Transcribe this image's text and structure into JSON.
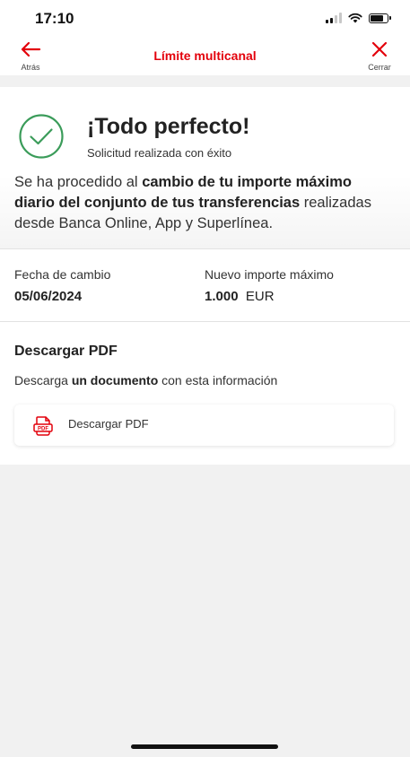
{
  "status_bar": {
    "time": "17:10"
  },
  "nav": {
    "title": "Límite multicanal",
    "back_label": "Atrás",
    "close_label": "Cerrar"
  },
  "success": {
    "title": "¡Todo perfecto!",
    "subtitle": "Solicitud realizada con éxito",
    "description_prefix": "Se ha procedido al ",
    "description_bold": "cambio de tu importe máximo diario del conjunto de tus transferencias",
    "description_suffix": " realizadas desde Banca Online, App y Superlínea."
  },
  "details": {
    "date_label": "Fecha de cambio",
    "date_value": "05/06/2024",
    "amount_label": "Nuevo importe máximo",
    "amount_value": "1.000",
    "amount_currency": "EUR"
  },
  "pdf": {
    "heading": "Descargar PDF",
    "desc_prefix": "Descarga ",
    "desc_bold": "un documento",
    "desc_suffix": " con esta información",
    "button_label": "Descargar PDF",
    "icon_text": "PDF"
  },
  "colors": {
    "brand_red": "#e3000b",
    "success_green": "#3b9c5a"
  },
  "icons": {
    "back": "arrow-left-icon",
    "close": "close-icon",
    "check": "check-circle-icon",
    "pdf": "pdf-file-icon"
  }
}
